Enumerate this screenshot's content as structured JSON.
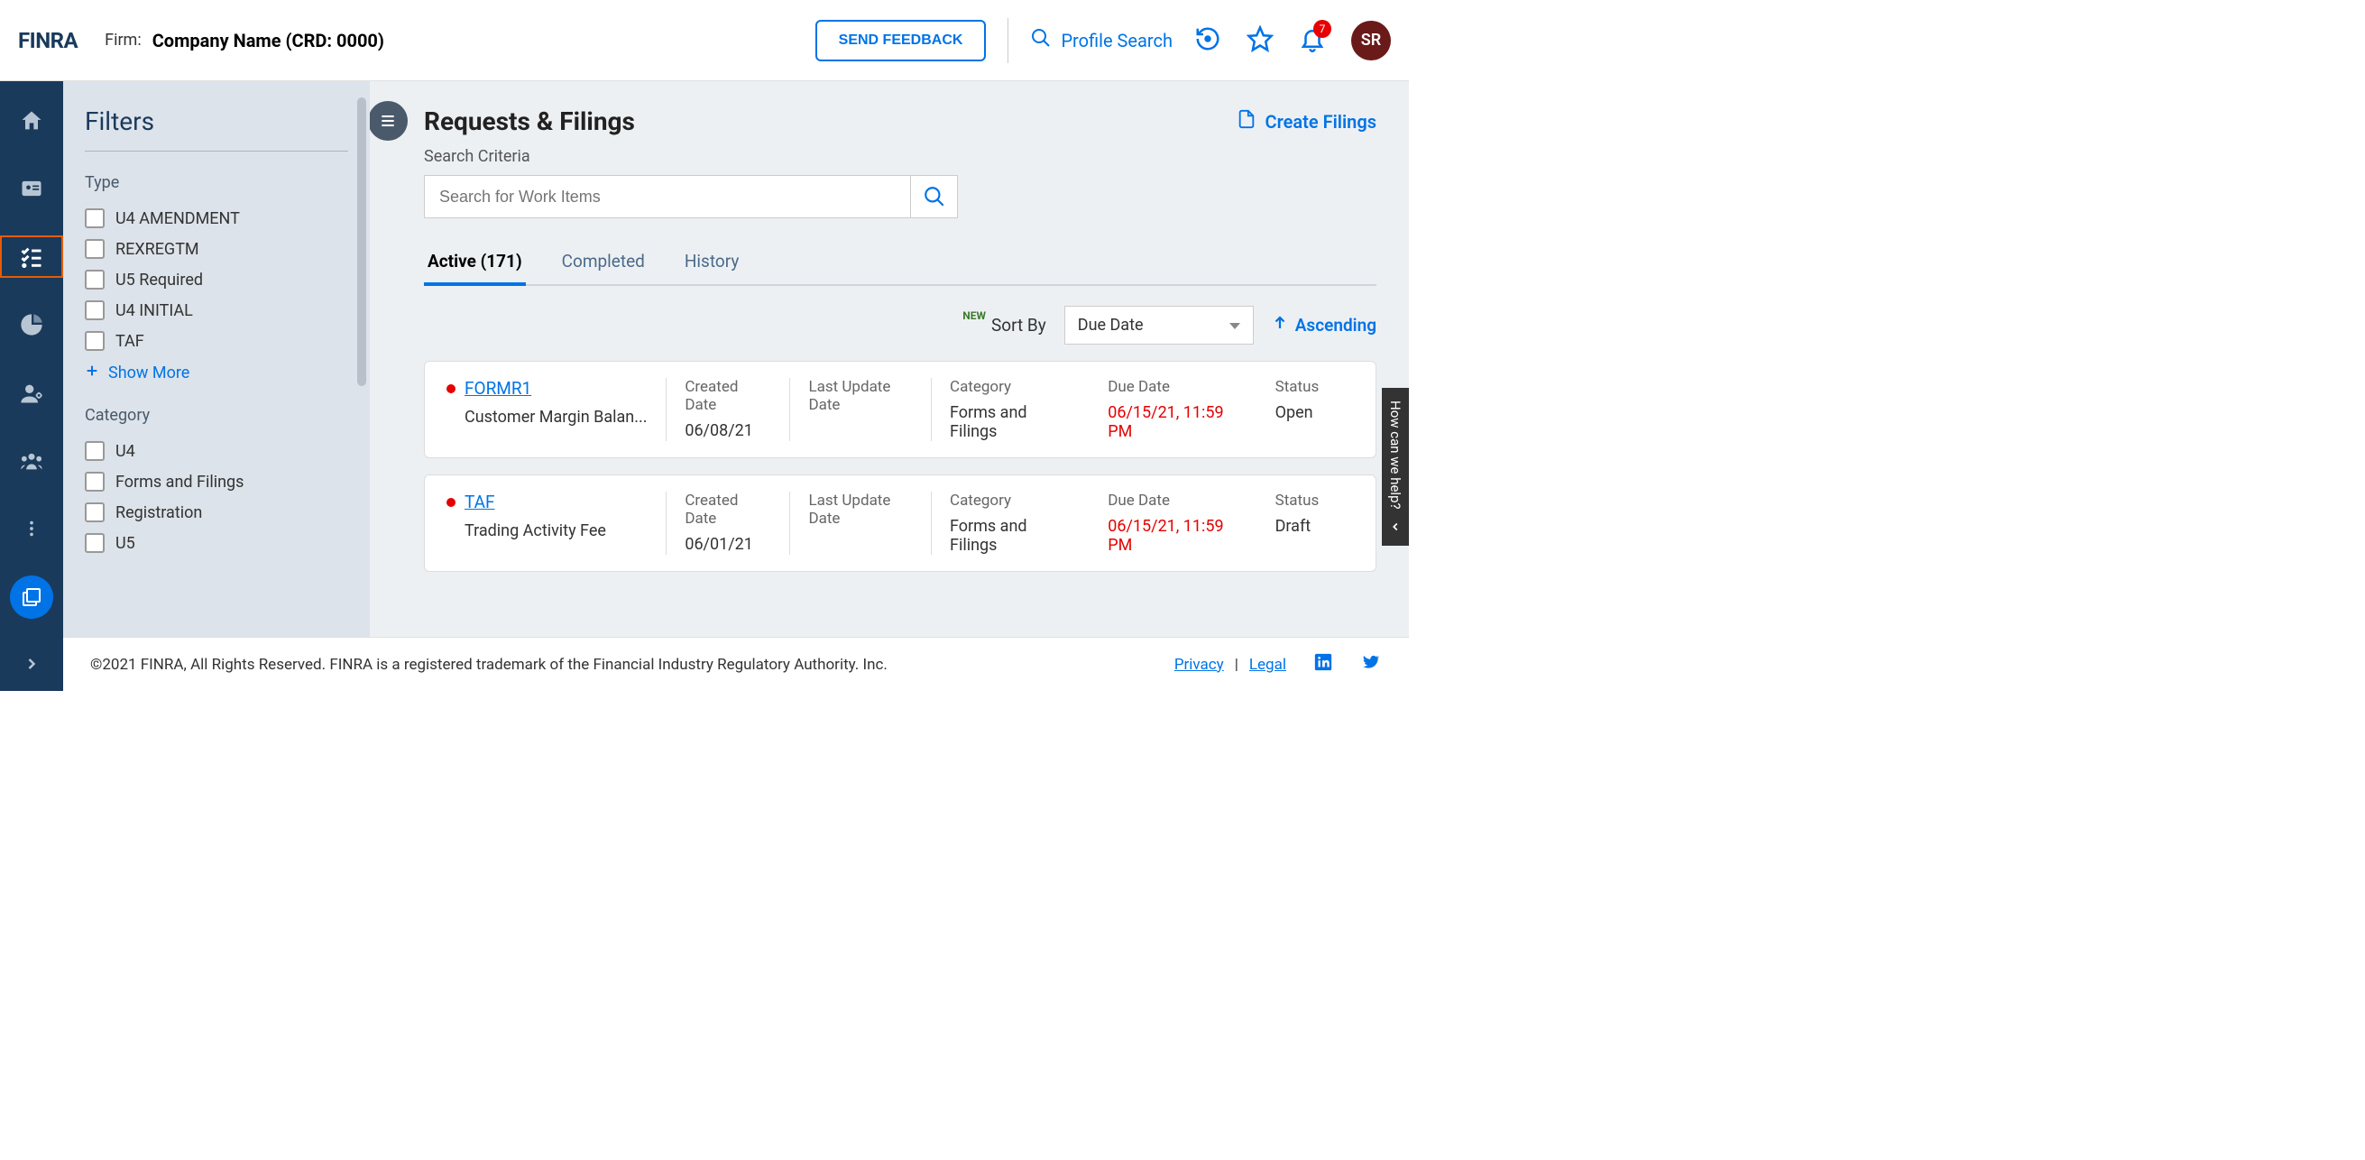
{
  "header": {
    "logo": "FINRA",
    "firm_label": "Firm:",
    "firm_name": "Company Name (CRD: 0000)",
    "feedback_btn": "SEND FEEDBACK",
    "profile_search": "Profile Search",
    "notification_count": "7",
    "avatar_initials": "SR"
  },
  "filters": {
    "title": "Filters",
    "type_label": "Type",
    "types": [
      "U4 AMENDMENT",
      "REXREGTM",
      "U5 Required",
      "U4 INITIAL",
      "TAF"
    ],
    "show_more": "Show More",
    "category_label": "Category",
    "categories": [
      "U4",
      "Forms and Filings",
      "Registration",
      "U5"
    ]
  },
  "page": {
    "title": "Requests & Filings",
    "create_label": "Create Filings",
    "search_label": "Search Criteria",
    "search_placeholder": "Search for Work Items",
    "tabs": {
      "active": "Active (171)",
      "completed": "Completed",
      "history": "History"
    },
    "sort_new": "NEW",
    "sort_by_label": "Sort By",
    "sort_value": "Due Date",
    "sort_order": "Ascending"
  },
  "columns": {
    "created": "Created Date",
    "updated": "Last Update Date",
    "category": "Category",
    "due": "Due Date",
    "status": "Status"
  },
  "items": [
    {
      "link": "FORMR1",
      "subtitle": "Customer Margin Balan...",
      "created": "06/08/21",
      "updated": "",
      "category": "Forms and Filings",
      "due": "06/15/21, 11:59 PM",
      "status": "Open"
    },
    {
      "link": "TAF",
      "subtitle": "Trading Activity Fee",
      "created": "06/01/21",
      "updated": "",
      "category": "Forms and Filings",
      "due": "06/15/21, 11:59 PM",
      "status": "Draft"
    }
  ],
  "footer": {
    "copyright": "©2021 FINRA, All Rights Reserved. FINRA is a registered trademark of the Financial Industry Regulatory Authority. Inc.",
    "privacy": "Privacy",
    "legal": "Legal"
  },
  "help_tab": "How can we help?"
}
